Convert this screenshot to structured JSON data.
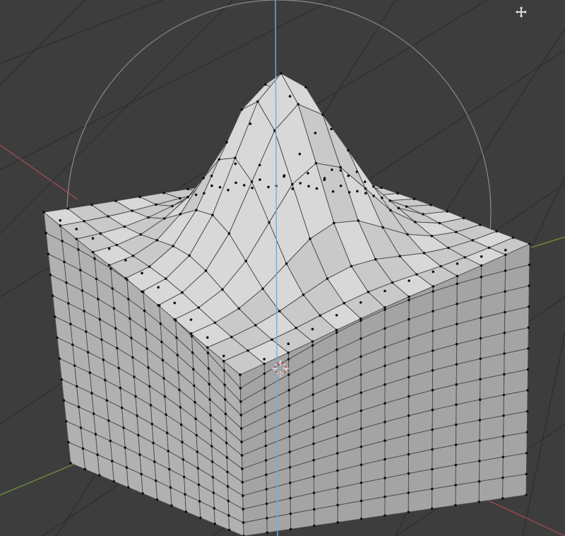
{
  "viewport": {
    "background_color": "#3d3d3d",
    "axis_colors": {
      "x": "#9a4a50",
      "y": "#6f8e3c",
      "z": "#6ab0e6"
    },
    "mesh": {
      "top_color": "#c9c9c9",
      "left_color": "#b1b1b1",
      "right_color": "#a4a4a4",
      "vertex_color": "#111111"
    },
    "toolbar": {
      "move_icon": "move-view-icon"
    },
    "cursor_icon": "3d-cursor-icon"
  }
}
